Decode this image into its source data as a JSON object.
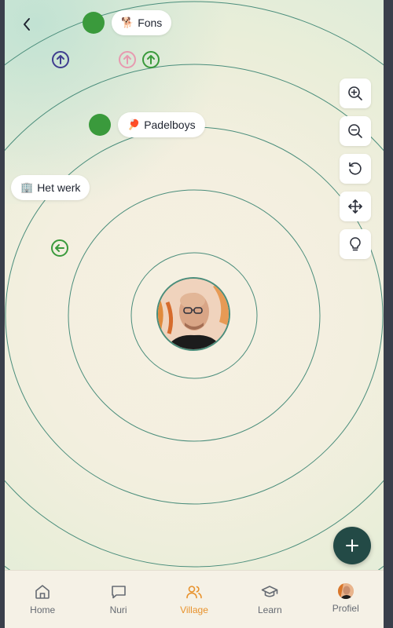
{
  "header": {
    "back_icon": "chevron-left-icon"
  },
  "groups": [
    {
      "label": "Fons",
      "emoji": "🐕",
      "color": "#3a9a3c"
    },
    {
      "label": "Padelboys",
      "emoji": "🏓",
      "color": "#3a9a3c"
    },
    {
      "label": "Het werk",
      "emoji": "🏢"
    }
  ],
  "markers": [
    {
      "icon": "arrow-up-circle-icon",
      "color": "#3f3d8f"
    },
    {
      "icon": "arrow-up-circle-icon",
      "color": "#e79ab0"
    },
    {
      "icon": "arrow-up-circle-icon",
      "color": "#3a9a3c"
    },
    {
      "icon": "arrow-left-circle-icon",
      "color": "#3a9a3c"
    }
  ],
  "toolbar": {
    "buttons": [
      "zoom-in-icon",
      "zoom-out-icon",
      "reset-rotate-icon",
      "move-icon",
      "lightbulb-icon"
    ]
  },
  "fab": {
    "icon": "plus-icon"
  },
  "nav": {
    "items": [
      {
        "label": "Home",
        "icon": "home-icon",
        "active": false
      },
      {
        "label": "Nuri",
        "icon": "chat-icon",
        "active": false
      },
      {
        "label": "Village",
        "icon": "users-icon",
        "active": true
      },
      {
        "label": "Learn",
        "icon": "graduation-cap-icon",
        "active": false
      },
      {
        "label": "Profiel",
        "icon": "profile-avatar-icon",
        "active": false
      }
    ],
    "active_color": "#e8922c",
    "inactive_color": "#666b73"
  },
  "colors": {
    "ring": "#4a8d7b",
    "fab_bg": "#234a46"
  }
}
